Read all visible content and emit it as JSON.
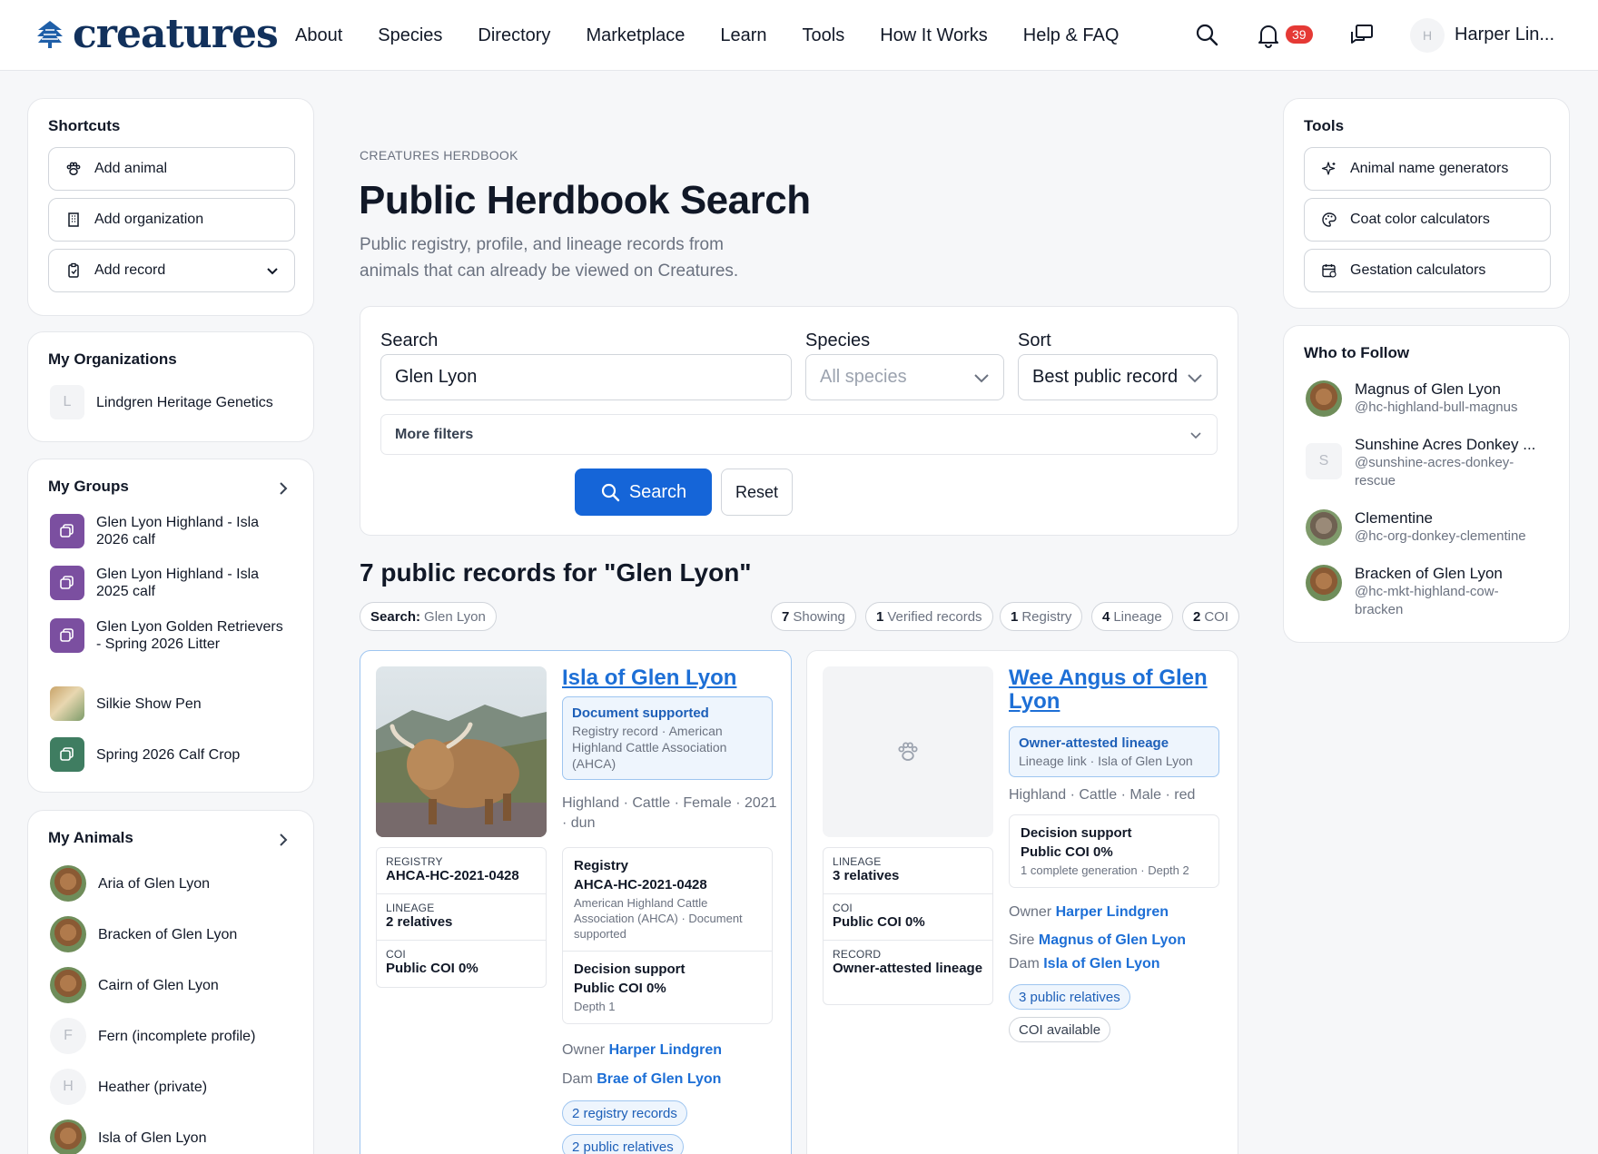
{
  "brand": {
    "name": "creatures",
    "color": "#12315c"
  },
  "nav": {
    "links": [
      "About",
      "Species",
      "Directory",
      "Marketplace",
      "Learn",
      "Tools",
      "How It Works",
      "Help & FAQ"
    ],
    "notifications": "39",
    "user_initial": "H",
    "user_name": "Harper Lin..."
  },
  "shortcuts": {
    "title": "Shortcuts",
    "items": [
      {
        "label": "Add animal",
        "icon": "paw-icon"
      },
      {
        "label": "Add organization",
        "icon": "building-icon"
      },
      {
        "label": "Add record",
        "icon": "clipboard-icon"
      }
    ]
  },
  "organizations": {
    "title": "My Organizations",
    "items": [
      {
        "initial": "L",
        "name": "Lindgren Heritage Genetics"
      }
    ]
  },
  "groups": {
    "title": "My Groups",
    "items": [
      {
        "name": "Glen Lyon Highland - Isla 2026 calf",
        "kind": "purple"
      },
      {
        "name": "Glen Lyon Highland - Isla 2025 calf",
        "kind": "purple"
      },
      {
        "name": "Glen Lyon Golden Retrievers - Spring 2026 Litter",
        "kind": "purple"
      },
      {
        "name": "Silkie Show Pen",
        "kind": "photo"
      },
      {
        "name": "Spring 2026 Calf Crop",
        "kind": "green"
      }
    ]
  },
  "animals": {
    "title": "My Animals",
    "items": [
      {
        "name": "Aria of Glen Lyon",
        "initial": ""
      },
      {
        "name": "Bracken of Glen Lyon",
        "initial": ""
      },
      {
        "name": "Cairn of Glen Lyon",
        "initial": ""
      },
      {
        "name": "Fern (incomplete profile)",
        "initial": "F"
      },
      {
        "name": "Heather (private)",
        "initial": "H"
      },
      {
        "name": "Isla of Glen Lyon",
        "initial": ""
      }
    ]
  },
  "page": {
    "eyebrow": "CREATURES HERDBOOK",
    "title": "Public Herdbook Search",
    "subtitle": "Public registry, profile, and lineage records from animals that can already be viewed on Creatures."
  },
  "search": {
    "search_label": "Search",
    "search_value": "Glen Lyon",
    "species_label": "Species",
    "species_value": "All species",
    "sort_label": "Sort",
    "sort_value": "Best public record",
    "more_filters": "More filters",
    "search_button": "Search",
    "reset_button": "Reset"
  },
  "results": {
    "heading": "7 public records for \"Glen Lyon\"",
    "query_chip_label": "Search:",
    "query_chip_value": "Glen Lyon",
    "stats": [
      {
        "count": "7",
        "label": "Showing"
      },
      {
        "count": "1",
        "label": "Verified records"
      },
      {
        "count": "1",
        "label": "Registry"
      },
      {
        "count": "4",
        "label": "Lineage"
      },
      {
        "count": "2",
        "label": "COI"
      }
    ]
  },
  "records": [
    {
      "name": "Isla of Glen Lyon",
      "badge_title": "Document supported",
      "badge_sub": "Registry record · American Highland Cattle Association (AHCA)",
      "meta": "Highland · Cattle · Female · 2021 · dun",
      "kv": [
        {
          "label": "REGISTRY",
          "value": "AHCA-HC-2021-0428"
        },
        {
          "label": "LINEAGE",
          "value": "2 relatives"
        },
        {
          "label": "COI",
          "value": "Public COI 0%"
        }
      ],
      "detail": {
        "registry_head": "Registry",
        "registry_value": "AHCA-HC-2021-0428",
        "registry_note": "American Highland Cattle Association (AHCA) · Document supported",
        "decision_head": "Decision support",
        "decision_value": "Public COI 0%",
        "decision_note": "Depth 1"
      },
      "owner_label": "Owner",
      "owner": "Harper Lindgren",
      "dam_label": "Dam",
      "dam": "Brae of Glen Lyon",
      "pills": [
        "2 registry records",
        "2 public relatives"
      ]
    },
    {
      "name": "Wee Angus of Glen Lyon",
      "badge_title": "Owner-attested lineage",
      "badge_sub": "Lineage link · Isla of Glen Lyon",
      "meta": "Highland · Cattle · Male · red",
      "kv": [
        {
          "label": "LINEAGE",
          "value": "3 relatives"
        },
        {
          "label": "COI",
          "value": "Public COI 0%"
        },
        {
          "label": "RECORD",
          "value": "Owner-attested lineage"
        }
      ],
      "detail": {
        "decision_head": "Decision support",
        "decision_value": "Public COI 0%",
        "decision_note": "1 complete generation · Depth 2"
      },
      "owner_label": "Owner",
      "owner": "Harper Lindgren",
      "sire_label": "Sire",
      "sire": "Magnus of Glen Lyon",
      "dam_label": "Dam",
      "dam": "Isla of Glen Lyon",
      "pills": [
        "3 public relatives"
      ],
      "grey_pill": "COI available"
    }
  ],
  "tools": {
    "title": "Tools",
    "items": [
      {
        "label": "Animal name generators",
        "icon": "sparkle-icon"
      },
      {
        "label": "Coat color calculators",
        "icon": "palette-icon"
      },
      {
        "label": "Gestation calculators",
        "icon": "calendar-icon"
      }
    ]
  },
  "follow": {
    "title": "Who to Follow",
    "items": [
      {
        "name": "Magnus of Glen Lyon",
        "handle": "@hc-highland-bull-magnus",
        "initial": ""
      },
      {
        "name": "Sunshine Acres Donkey ...",
        "handle": "@sunshine-acres-donkey-rescue",
        "initial": "S"
      },
      {
        "name": "Clementine",
        "handle": "@hc-org-donkey-clementine",
        "initial": ""
      },
      {
        "name": "Bracken of Glen Lyon",
        "handle": "@hc-mkt-highland-cow-bracken",
        "initial": ""
      }
    ]
  },
  "colors": {
    "accent": "#1565d8",
    "link": "#1d6fd6",
    "badge": "#e53935",
    "group_purple": "#7b4fa0",
    "group_green": "#3f7d61"
  }
}
